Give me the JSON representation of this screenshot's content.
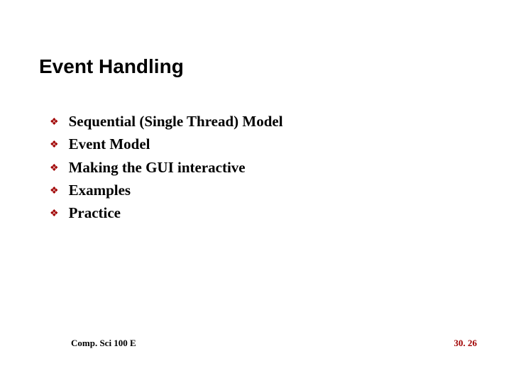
{
  "title": "Event Handling",
  "bullets": [
    "Sequential (Single Thread) Model",
    "Event Model",
    "Making the GUI interactive",
    "Examples",
    "Practice"
  ],
  "footer": {
    "course": "Comp. Sci 100 E",
    "page": "30. 26"
  },
  "colors": {
    "accent": "#a00000"
  }
}
